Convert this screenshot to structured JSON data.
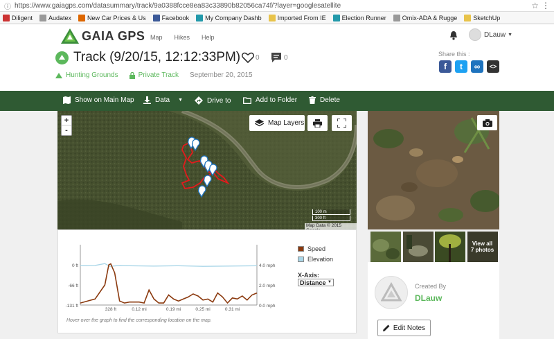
{
  "browser": {
    "url": "https://www.gaiagps.com/datasummary/track/9a0388fcce8ea83c33890b82056ca74f/?layer=googlesatellite",
    "bookmarks": [
      {
        "label": "Diligent",
        "color": "#c33"
      },
      {
        "label": "Audatex",
        "color": "#999"
      },
      {
        "label": "New Car Prices & Us",
        "color": "#d60"
      },
      {
        "label": "Facebook",
        "color": "#3b5998"
      },
      {
        "label": "My Company Dashb",
        "color": "#29a"
      },
      {
        "label": "Imported From IE",
        "color": "#e8c34a"
      },
      {
        "label": "Election Runner",
        "color": "#29a"
      },
      {
        "label": "Omix-ADA & Rugge",
        "color": "#999"
      },
      {
        "label": "SketchUp",
        "color": "#e8c34a"
      }
    ]
  },
  "header": {
    "brand": "GAIA GPS",
    "nav": [
      "Map",
      "Hikes",
      "Help"
    ],
    "user": "DLauw"
  },
  "track": {
    "title": "Track (9/20/15, 12:12:33PM)",
    "likes": "0",
    "comments": "0",
    "activity": "Hunting Grounds",
    "privacy": "Private Track",
    "date": "September 20, 2015"
  },
  "share": {
    "label": "Share this :",
    "buttons": [
      {
        "name": "facebook",
        "glyph": "f",
        "color": "#3b5998"
      },
      {
        "name": "twitter",
        "glyph": "t",
        "color": "#1da1f2"
      },
      {
        "name": "link",
        "glyph": "∞",
        "color": "#1e73be"
      },
      {
        "name": "embed",
        "glyph": "<>",
        "color": "#333"
      }
    ]
  },
  "toolbar": {
    "show_on_map": "Show on Main Map",
    "data": "Data",
    "drive_to": "Drive to",
    "add_to_folder": "Add to Folder",
    "delete": "Delete"
  },
  "map": {
    "zoom_in": "+",
    "zoom_out": "-",
    "layers_label": "Map Layers",
    "scale_top": "100 m",
    "scale_bottom": "300 ft",
    "attribution": "Map Data © 2015 Google"
  },
  "photos": {
    "view_all_line1": "View all",
    "view_all_line2": "7 photos"
  },
  "chart_data": {
    "type": "line",
    "series": [
      {
        "name": "Speed",
        "color": "#8b3a0f",
        "axis": "right",
        "x": [
          0,
          0.03,
          0.05,
          0.058,
          0.062,
          0.07,
          0.08,
          0.09,
          0.1,
          0.11,
          0.12,
          0.13,
          0.14,
          0.15,
          0.16,
          0.17,
          0.18,
          0.19,
          0.2,
          0.21,
          0.22,
          0.23,
          0.24,
          0.25,
          0.26,
          0.27,
          0.28,
          0.29,
          0.3,
          0.31,
          0.32,
          0.33,
          0.34,
          0.35,
          0.36
        ],
        "y": [
          0.2,
          0.6,
          2.0,
          4.0,
          4.1,
          3.2,
          0.4,
          0.2,
          0.3,
          0.3,
          0.3,
          0.2,
          1.5,
          0.6,
          0.2,
          0.2,
          1.0,
          0.6,
          0.4,
          0.6,
          0.8,
          1.1,
          0.9,
          0.5,
          0.6,
          0.3,
          1.2,
          0.8,
          0.2,
          0.7,
          0.6,
          0.9,
          0.5,
          1.0,
          1.2
        ]
      },
      {
        "name": "Elevation",
        "color": "#a9d6e8",
        "axis": "left",
        "x": [
          0,
          0.03,
          0.05,
          0.06,
          0.08,
          0.1,
          0.15,
          0.2,
          0.25,
          0.3,
          0.36
        ],
        "y": [
          -3,
          -2,
          4,
          -5,
          -2,
          -3,
          -4,
          -3,
          -5,
          -4,
          -3
        ]
      }
    ],
    "left_ticks": [
      "0 ft",
      "-66 ft",
      "-131 ft"
    ],
    "right_ticks": [
      "4.0 mph",
      "2.0 mph",
      "0.0 mph"
    ],
    "x_ticks": [
      "328 ft",
      "0.12 mi",
      "0.19 mi",
      "0.25 mi",
      "0.31 mi"
    ],
    "x_axis_label": "X-Axis:",
    "x_axis_option": "Distance",
    "hint": "Hover over the graph to find the corresponding location on the map."
  },
  "creator": {
    "label": "Created By",
    "name": "DLauw",
    "edit_notes": "Edit Notes"
  }
}
